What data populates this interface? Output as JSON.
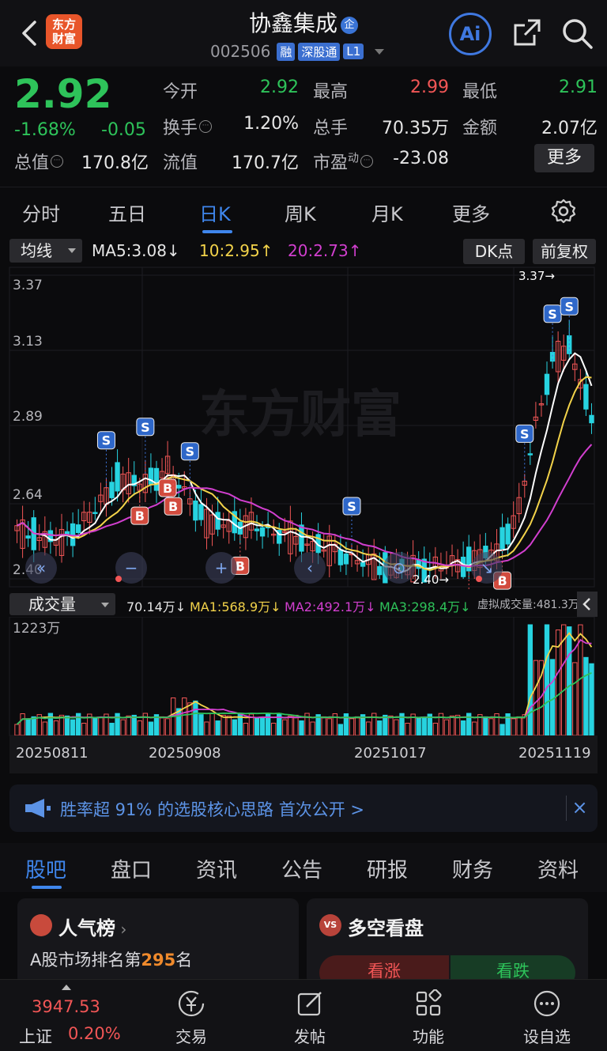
{
  "header": {
    "stock_name": "协鑫集成",
    "badge": "企",
    "code": "002506",
    "tags": [
      "融",
      "深股通",
      "L1"
    ],
    "logo_text": "东方\n财富",
    "ai_label": "Ai"
  },
  "quote": {
    "price": "2.92",
    "change_pct": "-1.68%",
    "change_abs": "-0.05",
    "fields": [
      {
        "label": "今开",
        "value": "2.92",
        "color": "#2ec35a"
      },
      {
        "label": "最高",
        "value": "2.99",
        "color": "#f25656"
      },
      {
        "label": "最低",
        "value": "2.91",
        "color": "#2ec35a"
      },
      {
        "label": "换手",
        "value": "1.20%",
        "color": "#e6e6e6"
      },
      {
        "label": "总手",
        "value": "70.35万",
        "color": "#e6e6e6"
      },
      {
        "label": "金额",
        "value": "2.07亿",
        "color": "#e6e6e6"
      },
      {
        "label": "总值",
        "value": "170.8亿",
        "color": "#e6e6e6"
      },
      {
        "label": "流值",
        "value": "170.7亿",
        "color": "#e6e6e6"
      },
      {
        "label": "市盈",
        "value": "-23.08",
        "color": "#e6e6e6"
      }
    ],
    "pe_sup": "动",
    "more_label": "更多"
  },
  "tabs": [
    "分时",
    "五日",
    "日K",
    "周K",
    "月K",
    "更多"
  ],
  "ma_bar": {
    "select": "均线",
    "ma5": "MA5:3.08↓",
    "ma10": "10:2.95↑",
    "ma20": "20:2.73↑",
    "dk": "DK点",
    "fq": "前复权"
  },
  "chart_data": {
    "type": "candlestick",
    "y_ticks": [
      "3.37",
      "3.13",
      "2.89",
      "2.64",
      "2.40"
    ],
    "ylim": [
      2.4,
      3.37
    ],
    "x_ticks": [
      "20250811",
      "20250908",
      "20251017",
      "20251119"
    ],
    "high_label": "3.37→",
    "low_label": "2.40→",
    "watermark": "东方财富",
    "signals": [
      {
        "type": "S",
        "index": 16
      },
      {
        "type": "S",
        "index": 23
      },
      {
        "type": "S",
        "index": 31
      },
      {
        "type": "S",
        "index": 60
      },
      {
        "type": "S",
        "index": 91
      },
      {
        "type": "S",
        "index": 96
      },
      {
        "type": "S",
        "index": 99
      },
      {
        "type": "B",
        "index": 22
      },
      {
        "type": "B",
        "index": 27
      },
      {
        "type": "B",
        "index": 28
      },
      {
        "type": "B",
        "index": 40
      },
      {
        "type": "B",
        "index": 81
      },
      {
        "type": "B",
        "index": 87
      }
    ]
  },
  "volume": {
    "select": "成交量",
    "vol": "70.14万↓",
    "ma1": "MA1:568.9万↓",
    "ma2": "MA2:492.1万↓",
    "ma3": "MA3:298.4万↓",
    "virtual": "虚拟成交量:481.3万",
    "max_label": "1223万"
  },
  "banner": {
    "text": "胜率超 91% 的选股核心思路 首次公开 >",
    "close": "×"
  },
  "bottom_tabs": [
    "股吧",
    "盘口",
    "资讯",
    "公告",
    "研报",
    "财务",
    "资料"
  ],
  "cards": {
    "popularity_title": "人气榜",
    "rank_prefix": "A股市场排名第",
    "rank_num": "295",
    "rank_suffix": "名",
    "vs_title": "多空看盘",
    "vs_icon": "VS",
    "vs_up": "看涨",
    "vs_down": "看跌"
  },
  "bottom_nav": {
    "index_value": "3947.53",
    "index_name": "上证",
    "index_pct": "0.20%",
    "items": [
      "交易",
      "发帖",
      "功能",
      "设自选"
    ]
  }
}
